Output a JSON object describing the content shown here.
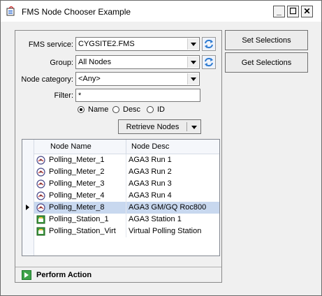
{
  "window": {
    "title": "FMS Node Chooser Example",
    "min": "_",
    "max": "☐",
    "close": "✕"
  },
  "form": {
    "fms_service_label": "FMS service:",
    "fms_service_value": "CYGSITE2.FMS",
    "group_label": "Group:",
    "group_value": "All Nodes",
    "node_category_label": "Node category:",
    "node_category_value": "<Any>",
    "filter_label": "Filter:",
    "filter_value": "*",
    "radio_name": "Name",
    "radio_desc": "Desc",
    "radio_id": "ID",
    "selected_radio": "Name",
    "retrieve_label": "Retrieve Nodes"
  },
  "grid": {
    "headers": [
      "Node Name",
      "Node Desc"
    ],
    "rows": [
      {
        "name": "Polling_Meter_1",
        "desc": "AGA3 Run 1",
        "icon": "meter-icon"
      },
      {
        "name": "Polling_Meter_2",
        "desc": "AGA3 Run 2",
        "icon": "meter-icon"
      },
      {
        "name": "Polling_Meter_3",
        "desc": "AGA3 Run 3",
        "icon": "meter-icon"
      },
      {
        "name": "Polling_Meter_4",
        "desc": "AGA3 Run 4",
        "icon": "meter-icon"
      },
      {
        "name": "Polling_Meter_8",
        "desc": "AGA3 GM/GQ Roc800",
        "icon": "meter-icon"
      },
      {
        "name": "Polling_Station_1",
        "desc": "AGA3 Station 1",
        "icon": "station-icon"
      },
      {
        "name": "Polling_Station_Virt",
        "desc": "Virtual Polling Station",
        "icon": "station-icon"
      }
    ],
    "selected_index": 4
  },
  "buttons": {
    "set_selections": "Set Selections",
    "get_selections": "Get Selections"
  },
  "footer": {
    "action_label": "Perform Action"
  },
  "colors": {
    "selection": "#c8d8ef",
    "refresh": "#2e7bd1",
    "action": "#3ea34a"
  }
}
